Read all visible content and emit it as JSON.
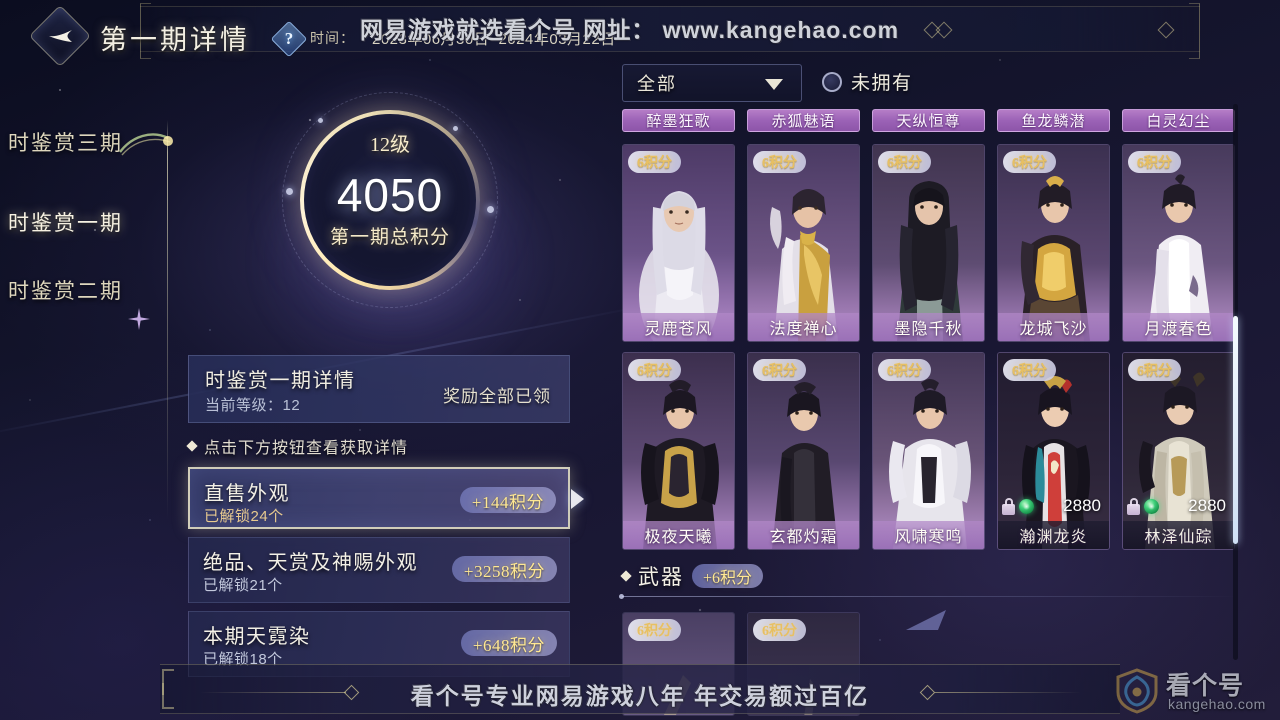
{
  "header": {
    "back_icon": "back-arrow-diamond-icon",
    "title": "第一期详情",
    "help_icon": "question-mark-icon",
    "time_label": "时间：",
    "time_value": "2023年06月30日~2024年03月22日",
    "watermark_top": "网易游戏就选看个号  网址： www.kangehao.com"
  },
  "sidebar": {
    "items": [
      {
        "label": "时鉴赏一期",
        "active": true
      },
      {
        "label": "时鉴赏二期",
        "active": false
      },
      {
        "label": "时鉴赏三期",
        "active": false
      }
    ]
  },
  "score": {
    "level": "12级",
    "value": "4050",
    "caption": "第一期总积分"
  },
  "detail_panel": {
    "title": "时鉴赏一期详情",
    "subtitle": "当前等级：12",
    "status": "奖励全部已领",
    "hint": "点击下方按钮查看获取详情",
    "rows": [
      {
        "title": "直售外观",
        "sub": "已解锁24个",
        "badge": "+144积分",
        "selected": true
      },
      {
        "title": "绝品、天赏及神赐外观",
        "sub": "已解锁21个",
        "badge": "+3258积分",
        "selected": false
      },
      {
        "title": "本期天霓染",
        "sub": "已解锁18个",
        "badge": "+648积分",
        "selected": false
      }
    ]
  },
  "right_pane": {
    "filter": {
      "value": "全部",
      "caret_icon": "chevron-down-icon"
    },
    "checkbox": {
      "label": "未拥有",
      "checked": false
    },
    "set_tags": [
      "醉墨狂歌",
      "赤狐魅语",
      "天纵恒尊",
      "鱼龙鳞潜",
      "白灵幻尘"
    ],
    "cards": [
      [
        {
          "name": "灵鹿苍风",
          "points": "6积分",
          "locked": false,
          "tone": "white-silver"
        },
        {
          "name": "法度禅心",
          "points": "6积分",
          "locked": false,
          "tone": "gold-white"
        },
        {
          "name": "墨隐千秋",
          "points": "6积分",
          "locked": false,
          "tone": "dark-green"
        },
        {
          "name": "龙城飞沙",
          "points": "6积分",
          "locked": false,
          "tone": "gold-black"
        },
        {
          "name": "月渡春色",
          "points": "6积分",
          "locked": false,
          "tone": "white-cream"
        }
      ],
      [
        {
          "name": "极夜天曦",
          "points": "6积分",
          "locked": false,
          "tone": "black-gold"
        },
        {
          "name": "玄都灼霜",
          "points": "6积分",
          "locked": false,
          "tone": "black"
        },
        {
          "name": "风啸寒鸣",
          "points": "6积分",
          "locked": false,
          "tone": "white-armor"
        },
        {
          "name": "瀚渊龙炎",
          "points": "6积分",
          "locked": true,
          "price": "2880",
          "currency_icon": "green-gem-icon",
          "lock_icon": "lock-icon",
          "tone": "red-black"
        },
        {
          "name": "林泽仙踪",
          "points": "6积分",
          "locked": true,
          "price": "2880",
          "currency_icon": "green-gem-icon",
          "lock_icon": "lock-icon",
          "tone": "pale-gold"
        }
      ]
    ],
    "weapon_section": {
      "title": "武器",
      "badge": "+6积分",
      "cards": [
        {
          "points": "6积分",
          "tone": "violet"
        },
        {
          "points": "6积分",
          "tone": "dark-violet"
        }
      ]
    },
    "scrollbar": {
      "name": "vertical-scrollbar"
    }
  },
  "footer": {
    "banner_text": "看个号专业网易游戏八年   年交易额过百亿",
    "logo_name": "看个号",
    "logo_url": "kangehao.com"
  },
  "colors": {
    "accent_gold": "#ffe893",
    "tag_purple": "#9b62b6",
    "panel_blue": "#2e3460",
    "gem_green": "#3fd07a"
  }
}
